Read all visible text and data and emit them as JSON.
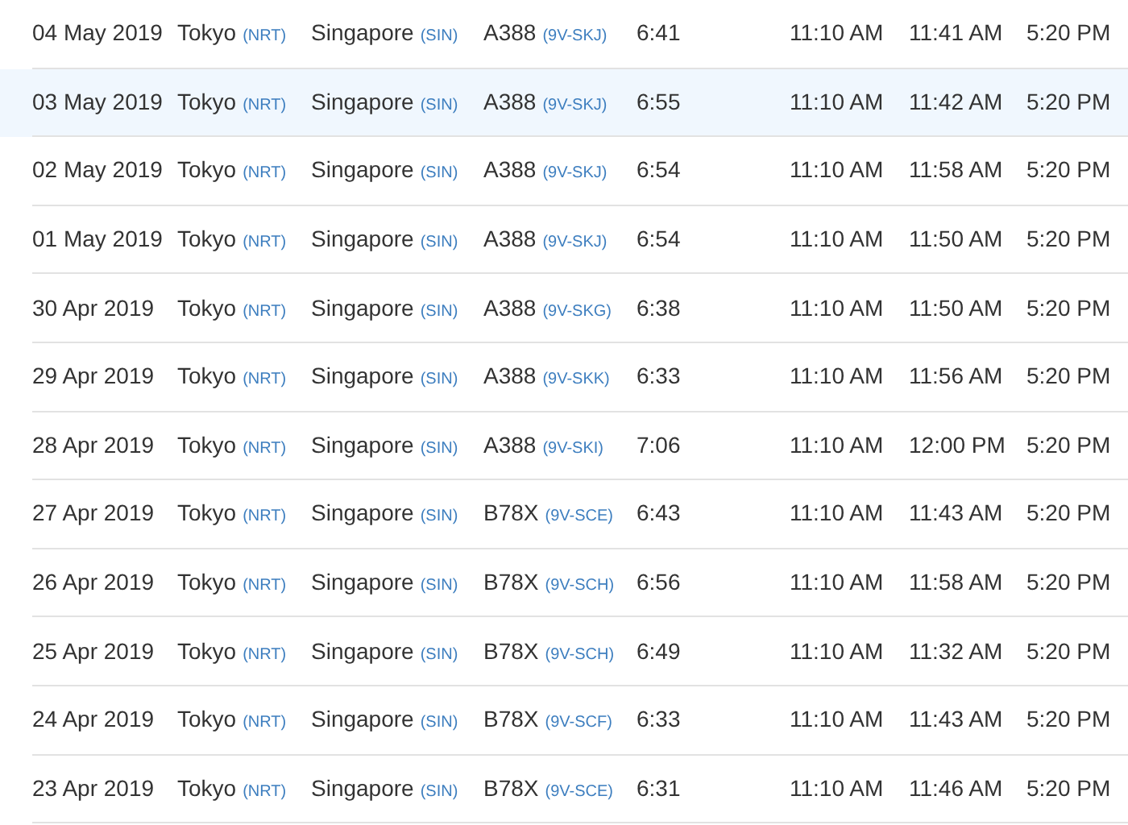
{
  "rows": [
    {
      "selected": false,
      "date": "04 May 2019",
      "from": {
        "city": "Tokyo",
        "code": "(NRT)"
      },
      "to": {
        "city": "Singapore",
        "code": "(SIN)"
      },
      "aircraft": {
        "type": "A388",
        "registration": "(9V-SKJ)"
      },
      "column_5": "6:41",
      "column_6": "11:10 AM",
      "column_7": "11:41 AM",
      "column_8": "5:20 PM"
    },
    {
      "selected": true,
      "date": "03 May 2019",
      "from": {
        "city": "Tokyo",
        "code": "(NRT)"
      },
      "to": {
        "city": "Singapore",
        "code": "(SIN)"
      },
      "aircraft": {
        "type": "A388",
        "registration": "(9V-SKJ)"
      },
      "column_5": "6:55",
      "column_6": "11:10 AM",
      "column_7": "11:42 AM",
      "column_8": "5:20 PM"
    },
    {
      "selected": false,
      "date": "02 May 2019",
      "from": {
        "city": "Tokyo",
        "code": "(NRT)"
      },
      "to": {
        "city": "Singapore",
        "code": "(SIN)"
      },
      "aircraft": {
        "type": "A388",
        "registration": "(9V-SKJ)"
      },
      "column_5": "6:54",
      "column_6": "11:10 AM",
      "column_7": "11:58 AM",
      "column_8": "5:20 PM"
    },
    {
      "selected": false,
      "date": "01 May 2019",
      "from": {
        "city": "Tokyo",
        "code": "(NRT)"
      },
      "to": {
        "city": "Singapore",
        "code": "(SIN)"
      },
      "aircraft": {
        "type": "A388",
        "registration": "(9V-SKJ)"
      },
      "column_5": "6:54",
      "column_6": "11:10 AM",
      "column_7": "11:50 AM",
      "column_8": "5:20 PM"
    },
    {
      "selected": false,
      "date": "30 Apr 2019",
      "from": {
        "city": "Tokyo",
        "code": "(NRT)"
      },
      "to": {
        "city": "Singapore",
        "code": "(SIN)"
      },
      "aircraft": {
        "type": "A388",
        "registration": "(9V-SKG)"
      },
      "column_5": "6:38",
      "column_6": "11:10 AM",
      "column_7": "11:50 AM",
      "column_8": "5:20 PM"
    },
    {
      "selected": false,
      "date": "29 Apr 2019",
      "from": {
        "city": "Tokyo",
        "code": "(NRT)"
      },
      "to": {
        "city": "Singapore",
        "code": "(SIN)"
      },
      "aircraft": {
        "type": "A388",
        "registration": "(9V-SKK)"
      },
      "column_5": "6:33",
      "column_6": "11:10 AM",
      "column_7": "11:56 AM",
      "column_8": "5:20 PM"
    },
    {
      "selected": false,
      "date": "28 Apr 2019",
      "from": {
        "city": "Tokyo",
        "code": "(NRT)"
      },
      "to": {
        "city": "Singapore",
        "code": "(SIN)"
      },
      "aircraft": {
        "type": "A388",
        "registration": "(9V-SKI)"
      },
      "column_5": "7:06",
      "column_6": "11:10 AM",
      "column_7": "12:00 PM",
      "column_8": "5:20 PM"
    },
    {
      "selected": false,
      "date": "27 Apr 2019",
      "from": {
        "city": "Tokyo",
        "code": "(NRT)"
      },
      "to": {
        "city": "Singapore",
        "code": "(SIN)"
      },
      "aircraft": {
        "type": "B78X",
        "registration": "(9V-SCE)"
      },
      "column_5": "6:43",
      "column_6": "11:10 AM",
      "column_7": "11:43 AM",
      "column_8": "5:20 PM"
    },
    {
      "selected": false,
      "date": "26 Apr 2019",
      "from": {
        "city": "Tokyo",
        "code": "(NRT)"
      },
      "to": {
        "city": "Singapore",
        "code": "(SIN)"
      },
      "aircraft": {
        "type": "B78X",
        "registration": "(9V-SCH)"
      },
      "column_5": "6:56",
      "column_6": "11:10 AM",
      "column_7": "11:58 AM",
      "column_8": "5:20 PM"
    },
    {
      "selected": false,
      "date": "25 Apr 2019",
      "from": {
        "city": "Tokyo",
        "code": "(NRT)"
      },
      "to": {
        "city": "Singapore",
        "code": "(SIN)"
      },
      "aircraft": {
        "type": "B78X",
        "registration": "(9V-SCH)"
      },
      "column_5": "6:49",
      "column_6": "11:10 AM",
      "column_7": "11:32 AM",
      "column_8": "5:20 PM"
    },
    {
      "selected": false,
      "date": "24 Apr 2019",
      "from": {
        "city": "Tokyo",
        "code": "(NRT)"
      },
      "to": {
        "city": "Singapore",
        "code": "(SIN)"
      },
      "aircraft": {
        "type": "B78X",
        "registration": "(9V-SCF)"
      },
      "column_5": "6:33",
      "column_6": "11:10 AM",
      "column_7": "11:43 AM",
      "column_8": "5:20 PM"
    },
    {
      "selected": false,
      "date": "23 Apr 2019",
      "from": {
        "city": "Tokyo",
        "code": "(NRT)"
      },
      "to": {
        "city": "Singapore",
        "code": "(SIN)"
      },
      "aircraft": {
        "type": "B78X",
        "registration": "(9V-SCE)"
      },
      "column_5": "6:31",
      "column_6": "11:10 AM",
      "column_7": "11:46 AM",
      "column_8": "5:20 PM"
    }
  ]
}
